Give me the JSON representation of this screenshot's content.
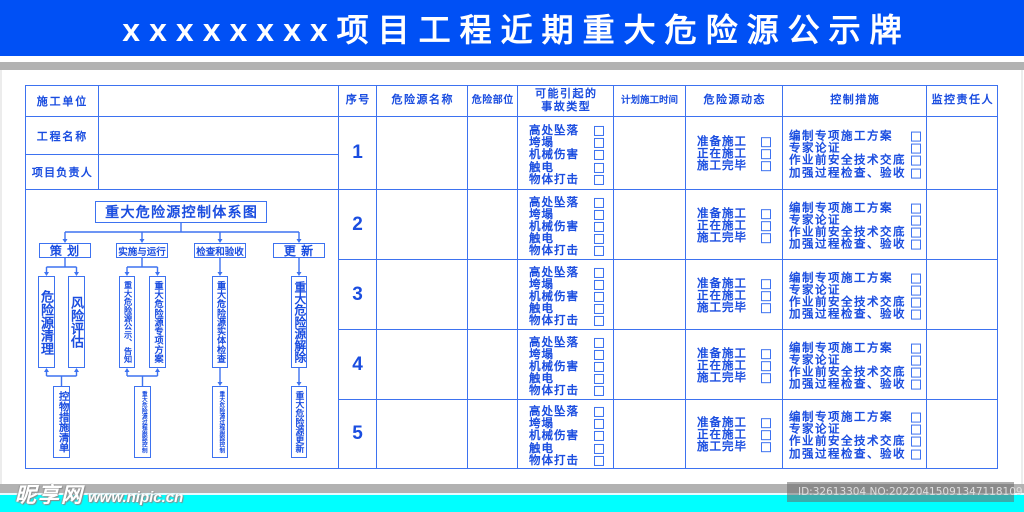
{
  "colors": {
    "header_bg": "#0050f5",
    "text": "#1a4de0",
    "border": "#3d72f0",
    "band_gray": "#b2b2b2",
    "footer_cyan": "#00ffff"
  },
  "header": {
    "title": "xxxxxxxx项目工程近期重大危险源公示牌"
  },
  "info": {
    "fields": [
      {
        "label": "施工单位",
        "value": ""
      },
      {
        "label": "工程名称",
        "value": ""
      },
      {
        "label": "项目负责人",
        "value": ""
      }
    ]
  },
  "table": {
    "columns": {
      "seq": "序号",
      "hazard_name": "危险源名称",
      "hazard_location": "危险部位",
      "accident_types_line1": "可能引起的",
      "accident_types_line2": "事故类型",
      "planned_time": "计划施工时间",
      "status": "危险源动态",
      "control_measures": "控制措施",
      "supervisor": "监控责任人"
    },
    "rows": [
      {
        "seq": "1",
        "hazard_name": "",
        "hazard_location": "",
        "planned_time": "",
        "supervisor": "",
        "accident_types": [
          {
            "label": "高处坠落",
            "checked": false
          },
          {
            "label": "垮塌",
            "checked": false
          },
          {
            "label": "机械伤害",
            "checked": false
          },
          {
            "label": "触电",
            "checked": false
          },
          {
            "label": "物体打击",
            "checked": false
          }
        ],
        "status": [
          {
            "label": "准备施工",
            "checked": false
          },
          {
            "label": "正在施工",
            "checked": false
          },
          {
            "label": "施工完毕",
            "checked": false
          }
        ],
        "control_measures": [
          {
            "label": "编制专项施工方案",
            "checked": false
          },
          {
            "label": "专家论证",
            "checked": false
          },
          {
            "label": "作业前安全技术交底",
            "checked": false
          },
          {
            "label": "加强过程检查、验收",
            "checked": false
          }
        ]
      },
      {
        "seq": "2",
        "hazard_name": "",
        "hazard_location": "",
        "planned_time": "",
        "supervisor": "",
        "accident_types": [
          {
            "label": "高处坠落",
            "checked": false
          },
          {
            "label": "垮塌",
            "checked": false
          },
          {
            "label": "机械伤害",
            "checked": false
          },
          {
            "label": "触电",
            "checked": false
          },
          {
            "label": "物体打击",
            "checked": false
          }
        ],
        "status": [
          {
            "label": "准备施工",
            "checked": false
          },
          {
            "label": "正在施工",
            "checked": false
          },
          {
            "label": "施工完毕",
            "checked": false
          }
        ],
        "control_measures": [
          {
            "label": "编制专项施工方案",
            "checked": false
          },
          {
            "label": "专家论证",
            "checked": false
          },
          {
            "label": "作业前安全技术交底",
            "checked": false
          },
          {
            "label": "加强过程检查、验收",
            "checked": false
          }
        ]
      },
      {
        "seq": "3",
        "hazard_name": "",
        "hazard_location": "",
        "planned_time": "",
        "supervisor": "",
        "accident_types": [
          {
            "label": "高处坠落",
            "checked": false
          },
          {
            "label": "垮塌",
            "checked": false
          },
          {
            "label": "机械伤害",
            "checked": false
          },
          {
            "label": "触电",
            "checked": false
          },
          {
            "label": "物体打击",
            "checked": false
          }
        ],
        "status": [
          {
            "label": "准备施工",
            "checked": false
          },
          {
            "label": "正在施工",
            "checked": false
          },
          {
            "label": "施工完毕",
            "checked": false
          }
        ],
        "control_measures": [
          {
            "label": "编制专项施工方案",
            "checked": false
          },
          {
            "label": "专家论证",
            "checked": false
          },
          {
            "label": "作业前安全技术交底",
            "checked": false
          },
          {
            "label": "加强过程检查、验收",
            "checked": false
          }
        ]
      },
      {
        "seq": "4",
        "hazard_name": "",
        "hazard_location": "",
        "planned_time": "",
        "supervisor": "",
        "accident_types": [
          {
            "label": "高处坠落",
            "checked": false
          },
          {
            "label": "垮塌",
            "checked": false
          },
          {
            "label": "机械伤害",
            "checked": false
          },
          {
            "label": "触电",
            "checked": false
          },
          {
            "label": "物体打击",
            "checked": false
          }
        ],
        "status": [
          {
            "label": "准备施工",
            "checked": false
          },
          {
            "label": "正在施工",
            "checked": false
          },
          {
            "label": "施工完毕",
            "checked": false
          }
        ],
        "control_measures": [
          {
            "label": "编制专项施工方案",
            "checked": false
          },
          {
            "label": "专家论证",
            "checked": false
          },
          {
            "label": "作业前安全技术交底",
            "checked": false
          },
          {
            "label": "加强过程检查、验收",
            "checked": false
          }
        ]
      },
      {
        "seq": "5",
        "hazard_name": "",
        "hazard_location": "",
        "planned_time": "",
        "supervisor": "",
        "accident_types": [
          {
            "label": "高处坠落",
            "checked": false
          },
          {
            "label": "垮塌",
            "checked": false
          },
          {
            "label": "机械伤害",
            "checked": false
          },
          {
            "label": "触电",
            "checked": false
          },
          {
            "label": "物体打击",
            "checked": false
          }
        ],
        "status": [
          {
            "label": "准备施工",
            "checked": false
          },
          {
            "label": "正在施工",
            "checked": false
          },
          {
            "label": "施工完毕",
            "checked": false
          }
        ],
        "control_measures": [
          {
            "label": "编制专项施工方案",
            "checked": false
          },
          {
            "label": "专家论证",
            "checked": false
          },
          {
            "label": "作业前安全技术交底",
            "checked": false
          },
          {
            "label": "加强过程检查、验收",
            "checked": false
          }
        ]
      }
    ]
  },
  "diagram": {
    "title": "重大危险源控制体系图",
    "branches": [
      {
        "label": "策 划",
        "steps": [
          "危险源清理",
          "风险评估"
        ],
        "result": "控物措施清单"
      },
      {
        "label": "实施与运行",
        "steps": [
          "重大危险源公示、告知",
          "重大危险源专项方案"
        ],
        "result": "重大危险源过程跟踪控制"
      },
      {
        "label": "检查和验收",
        "steps": [
          "重大危险源实体检查"
        ],
        "result": "重大危险源过程跟踪控制"
      },
      {
        "label": "更 新",
        "steps": [
          "重大危险源解除"
        ],
        "result": "重大危险源更新"
      }
    ]
  },
  "watermark": {
    "site_logo": "昵享网",
    "site_url": "www.nipic.cn",
    "image_id": "ID:32613304 NO:20220415091347118109"
  }
}
